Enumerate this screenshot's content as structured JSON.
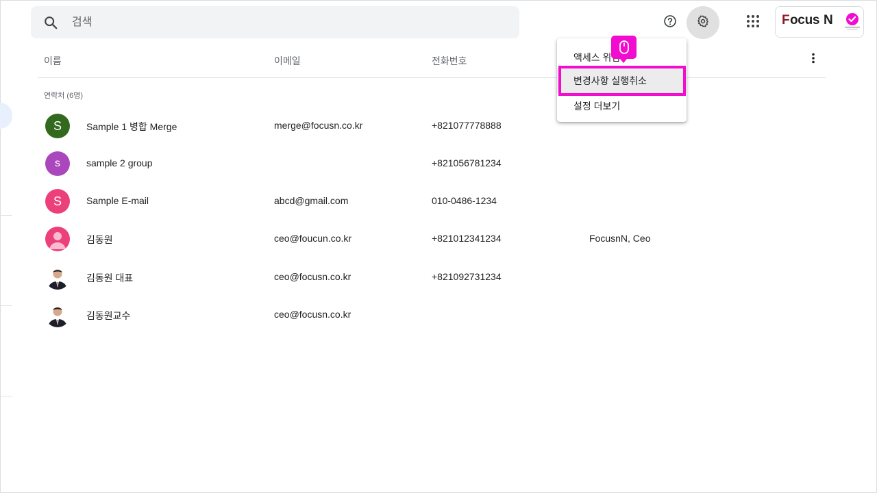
{
  "search": {
    "placeholder": "검색"
  },
  "header_icons": [
    "search-icon",
    "help-icon",
    "gear-icon",
    "apps-grid-icon",
    "more-vert-icon"
  ],
  "account": {
    "brand": "Focus N"
  },
  "table": {
    "columns": {
      "name": "이름",
      "email": "이메일",
      "phone": "전화번호"
    },
    "section_label": "연락처 (6명)",
    "rows": [
      {
        "initial": "S",
        "avatar_color": "#33691e",
        "name": "Sample 1 병합 Merge",
        "email": "merge@focusn.co.kr",
        "phone": "+821077778888",
        "job": ""
      },
      {
        "initial": "s",
        "avatar_color": "#ab47bc",
        "name": "sample 2 group",
        "email": "",
        "phone": "+821056781234",
        "job": ""
      },
      {
        "initial": "S",
        "avatar_color": "#ec407a",
        "name": "Sample E-mail",
        "email": "abcd@gmail.com",
        "phone": "010-0486-1234",
        "job": ""
      },
      {
        "initial": "",
        "avatar_color": "#ec407a",
        "name": "김동원",
        "email": "ceo@foucun.co.kr",
        "phone": "+821012341234",
        "job": "FocusnN, Ceo"
      },
      {
        "initial": "",
        "avatar_color": "",
        "name": "김동원 대표",
        "email": "ceo@focusn.co.kr",
        "phone": "+821092731234",
        "job": ""
      },
      {
        "initial": "",
        "avatar_color": "",
        "name": "김동원교수",
        "email": "ceo@focusn.co.kr",
        "phone": "",
        "job": ""
      }
    ]
  },
  "menu": {
    "items": [
      {
        "label": "액세스 위임"
      },
      {
        "label": "변경사항 실행취소"
      },
      {
        "label": "설정 더보기"
      }
    ]
  },
  "colors": {
    "highlight": "#f20cd0",
    "search_bg": "#f1f3f4"
  }
}
